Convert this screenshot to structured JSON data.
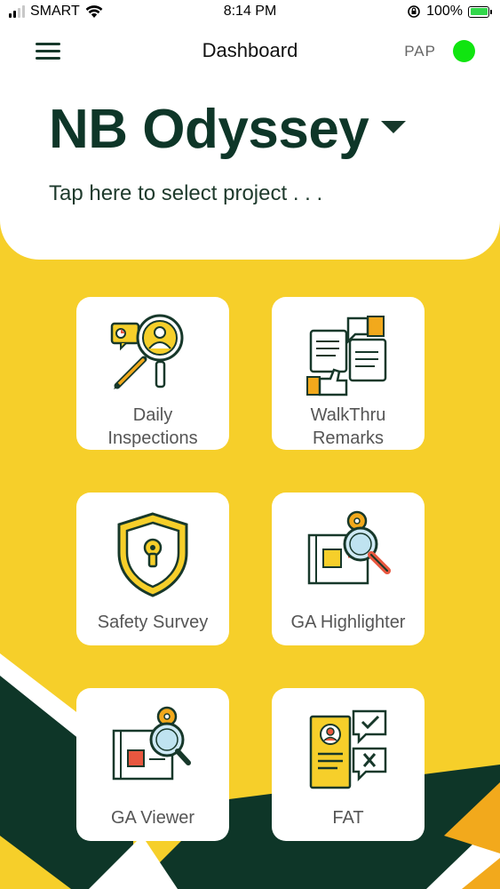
{
  "status_bar": {
    "carrier": "SMART",
    "time": "8:14 PM",
    "battery_percent": "100%"
  },
  "nav": {
    "title": "Dashboard",
    "user_initials": "PAP",
    "online_status_color": "#10e510"
  },
  "project": {
    "name": "NB Odyssey",
    "hint": "Tap here to select project . . ."
  },
  "colors": {
    "background": "#f6cf2a",
    "dark_green": "#0e3628",
    "card": "#ffffff"
  },
  "tiles": [
    {
      "label_line1": "Daily",
      "label_line2": "Inspections",
      "icon": "inspection-magnifier-icon"
    },
    {
      "label_line1": "WalkThru",
      "label_line2": "Remarks",
      "icon": "thumbs-feedback-icon"
    },
    {
      "label": "Safety Survey",
      "icon": "shield-lock-icon"
    },
    {
      "label": "GA Highlighter",
      "icon": "blueprint-highlighter-icon"
    },
    {
      "label": "GA Viewer",
      "icon": "blueprint-viewer-icon"
    },
    {
      "label": "FAT",
      "icon": "document-checklist-icon"
    }
  ]
}
